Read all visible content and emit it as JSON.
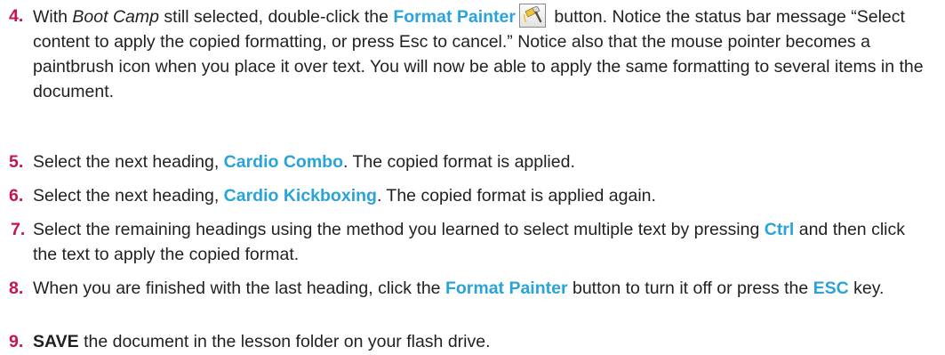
{
  "steps": [
    {
      "number": "4.",
      "parts": {
        "t1": "With ",
        "i1": "Boot Camp",
        "t2": " still selected, double-click the ",
        "k1": "Format Painter",
        "t3": " button. Notice the status bar message “Select content to apply the copied formatting, or press Esc to cancel.” Notice also that the mouse pointer becomes a paintbrush icon when you place it over text. You will now be able to apply the same formatting to several items in the document."
      },
      "icon": "format-painter-icon"
    },
    {
      "number": "5.",
      "parts": {
        "t1": "Select the next heading, ",
        "k1": "Cardio Combo",
        "t2": ". The copied format is applied."
      }
    },
    {
      "number": "6.",
      "parts": {
        "t1": "Select the next heading, ",
        "k1": "Cardio Kickboxing",
        "t2": ". The copied format is applied again."
      }
    },
    {
      "number": "7.",
      "parts": {
        "t1": "Select the remaining headings using the method you learned to select multiple text by pressing ",
        "k1": "Ctrl",
        "t2": " and then click the text to apply the copied format."
      }
    },
    {
      "number": "8.",
      "parts": {
        "t1": "When you are finished with the last heading, click the ",
        "k1": "Format Painter",
        "t2": " button to turn it off or press the ",
        "k2": "ESC",
        "t3": " key."
      }
    },
    {
      "number": "9.",
      "parts": {
        "b1": "SAVE",
        "t1": " the document in the lesson folder on your flash drive."
      }
    }
  ],
  "colors": {
    "step_number": "#c4154f",
    "keyword": "#2aa4d8",
    "body_text": "#231f20"
  }
}
